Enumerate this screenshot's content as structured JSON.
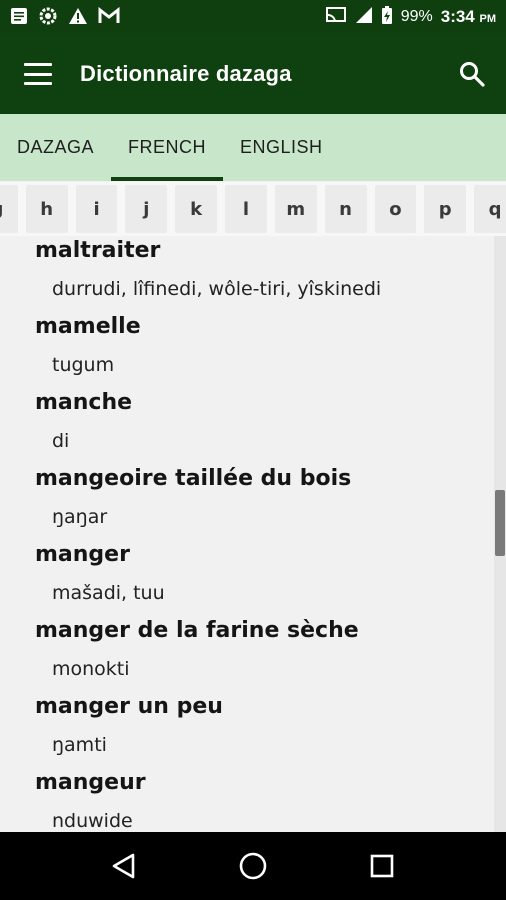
{
  "status_bar": {
    "battery": "99%",
    "time": "3:34",
    "ampm": "PM",
    "icons": [
      "notes-icon",
      "settings-icon",
      "warning-icon",
      "gmail-icon",
      "cast-icon",
      "signal-icon",
      "battery-charging-icon"
    ]
  },
  "app_bar": {
    "title": "Dictionnaire dazaga"
  },
  "tabs": [
    {
      "label": "DAZAGA"
    },
    {
      "label": "FRENCH"
    },
    {
      "label": "ENGLISH"
    }
  ],
  "active_tab": "FRENCH",
  "alphabet": [
    "g",
    "h",
    "i",
    "j",
    "k",
    "l",
    "m",
    "n",
    "o",
    "p",
    "q"
  ],
  "entries": [
    {
      "term": "maltraiter",
      "translation": "durrudi, lîfinedi, wôle-tiri, yîskinedi"
    },
    {
      "term": "mamelle",
      "translation": "tugum"
    },
    {
      "term": "manche",
      "translation": "di"
    },
    {
      "term": "mangeoire taillée du bois",
      "translation": "ŋaŋar"
    },
    {
      "term": "manger",
      "translation": "mašadi, tuu"
    },
    {
      "term": "manger de la farine sèche",
      "translation": "monokti"
    },
    {
      "term": "manger un peu",
      "translation": "ŋamti"
    },
    {
      "term": "mangeur",
      "translation": "nduwide"
    }
  ],
  "scroll_position": 0.48
}
